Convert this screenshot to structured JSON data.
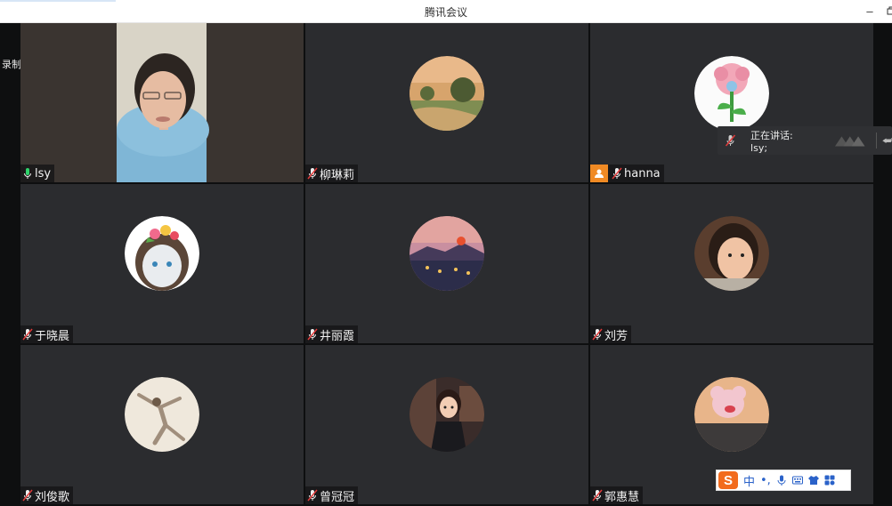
{
  "window": {
    "title": "腾讯会议"
  },
  "recording_label": "录制中",
  "participants": [
    {
      "name": "lsy",
      "speaking": true
    },
    {
      "name": "柳琳莉"
    },
    {
      "name": "hanna",
      "host": true
    },
    {
      "name": "于晓晨"
    },
    {
      "name": "井丽霞"
    },
    {
      "name": "刘芳"
    },
    {
      "name": "刘俊歌"
    },
    {
      "name": "曾冠冠"
    },
    {
      "name": "郭惠慧"
    }
  ],
  "speaking_indicator": {
    "label": "正在讲话: lsy;"
  },
  "ime_toolbar": {
    "mode": "中",
    "punct": "•,"
  },
  "colors": {
    "active_border": "#2fb36a",
    "host_badge": "#f08a24",
    "tile_bg": "#2b2c2f",
    "ime_brand": "#f26b1d"
  },
  "icons": [
    "microphone-icon",
    "microphone-muted-icon",
    "host-icon",
    "minimize-icon",
    "restore-icon",
    "keyboard-icon",
    "shirt-icon",
    "apps-icon"
  ]
}
